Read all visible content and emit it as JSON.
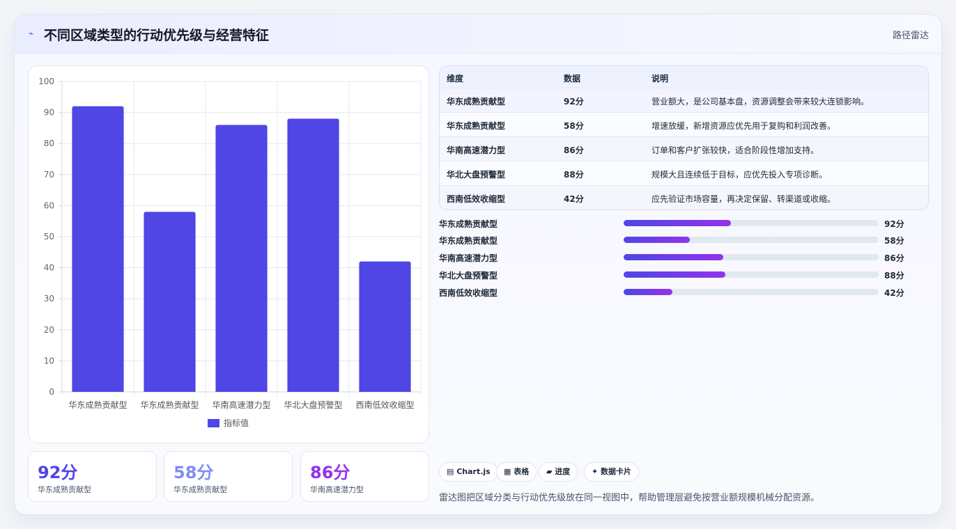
{
  "header": {
    "icon": "⌁",
    "title": "不同区域类型的行动优先级与经营特征",
    "right_label": "路径雷达"
  },
  "chart_data": {
    "type": "bar",
    "categories": [
      "华东成熟贡献型",
      "华东成熟贡献型",
      "华南高速潜力型",
      "华北大盘预警型",
      "西南低效收缩型"
    ],
    "series": [
      {
        "name": "指标值",
        "values": [
          92,
          58,
          86,
          88,
          42
        ]
      }
    ],
    "ylim": [
      0,
      100
    ],
    "yticks": [
      0,
      10,
      20,
      30,
      40,
      50,
      60,
      70,
      80,
      90,
      100
    ],
    "grid": true,
    "legend": "bottom",
    "color": "#4f46e5"
  },
  "table": {
    "headers": [
      "维度",
      "数据",
      "说明"
    ],
    "rows": [
      [
        "华东成熟贡献型",
        "92分",
        "营业额大，是公司基本盘，资源调整会带来较大连锁影响。"
      ],
      [
        "华东成熟贡献型",
        "58分",
        "增速放缓，新增资源应优先用于复购和利润改善。"
      ],
      [
        "华南高速潜力型",
        "86分",
        "订单和客户扩张较快，适合阶段性增加支持。"
      ],
      [
        "华北大盘预警型",
        "88分",
        "规模大且连续低于目标，应优先投入专项诊断。"
      ],
      [
        "西南低效收缩型",
        "42分",
        "应先验证市场容量，再决定保留、转渠道或收缩。"
      ]
    ]
  },
  "progress": [
    {
      "label": "华东成熟贡献型",
      "value": "92分",
      "fraction": 0.42
    },
    {
      "label": "华东成熟贡献型",
      "value": "58分",
      "fraction": 0.26
    },
    {
      "label": "华南高速潜力型",
      "value": "86分",
      "fraction": 0.39
    },
    {
      "label": "华北大盘预警型",
      "value": "88分",
      "fraction": 0.4
    },
    {
      "label": "西南低效收缩型",
      "value": "42分",
      "fraction": 0.19
    }
  ],
  "kpis": [
    {
      "value": "92分",
      "label": "华东成熟贡献型",
      "color": "#4f46e5"
    },
    {
      "value": "58分",
      "label": "华东成熟贡献型",
      "color": "#818cf8"
    },
    {
      "value": "86分",
      "label": "华南高速潜力型",
      "color": "#9333ea"
    }
  ],
  "tags": [
    "▤ Chart.js",
    "▦ 表格",
    "▰ 进度",
    "✦ 数据卡片"
  ],
  "footer": "雷达图把区域分类与行动优先级放在同一视图中，帮助管理层避免按营业额规模机械分配资源。"
}
